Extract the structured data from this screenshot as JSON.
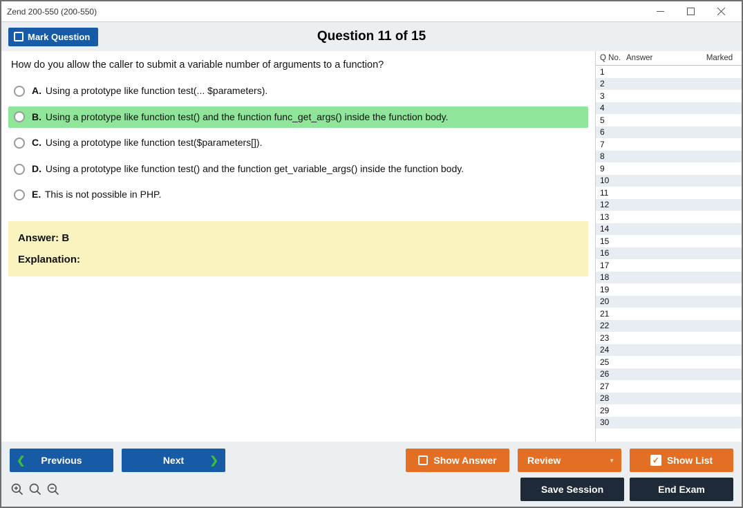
{
  "window": {
    "title": "Zend 200-550 (200-550)"
  },
  "header": {
    "mark_label": "Mark Question",
    "question_count": "Question 11 of 15"
  },
  "question": {
    "text": "How do you allow the caller to submit a variable number of arguments to a function?",
    "options": [
      {
        "letter": "A.",
        "text": "Using a prototype like function test(... $parameters).",
        "selected": false
      },
      {
        "letter": "B.",
        "text": "Using a prototype like function test() and the function func_get_args() inside the function body.",
        "selected": true
      },
      {
        "letter": "C.",
        "text": "Using a prototype like function test($parameters[]).",
        "selected": false
      },
      {
        "letter": "D.",
        "text": "Using a prototype like function test() and the function get_variable_args() inside the function body.",
        "selected": false
      },
      {
        "letter": "E.",
        "text": "This is not possible in PHP.",
        "selected": false
      }
    ],
    "answer_label": "Answer: ",
    "answer_value": "B",
    "explanation_label": "Explanation:",
    "explanation_text": ""
  },
  "navtable": {
    "header": {
      "qno": "Q No.",
      "answer": "Answer",
      "marked": "Marked"
    },
    "rows": [
      {
        "q": "1"
      },
      {
        "q": "2"
      },
      {
        "q": "3"
      },
      {
        "q": "4"
      },
      {
        "q": "5"
      },
      {
        "q": "6"
      },
      {
        "q": "7"
      },
      {
        "q": "8"
      },
      {
        "q": "9"
      },
      {
        "q": "10"
      },
      {
        "q": "11"
      },
      {
        "q": "12"
      },
      {
        "q": "13"
      },
      {
        "q": "14"
      },
      {
        "q": "15"
      },
      {
        "q": "16"
      },
      {
        "q": "17"
      },
      {
        "q": "18"
      },
      {
        "q": "19"
      },
      {
        "q": "20"
      },
      {
        "q": "21"
      },
      {
        "q": "22"
      },
      {
        "q": "23"
      },
      {
        "q": "24"
      },
      {
        "q": "25"
      },
      {
        "q": "26"
      },
      {
        "q": "27"
      },
      {
        "q": "28"
      },
      {
        "q": "29"
      },
      {
        "q": "30"
      }
    ]
  },
  "footer": {
    "previous": "Previous",
    "next": "Next",
    "show_answer": "Show Answer",
    "review": "Review",
    "show_list": "Show List",
    "save_session": "Save Session",
    "end_exam": "End Exam"
  },
  "icons": {
    "zoom_in": "zoom-in-icon",
    "zoom": "zoom-icon",
    "zoom_out": "zoom-out-icon"
  }
}
